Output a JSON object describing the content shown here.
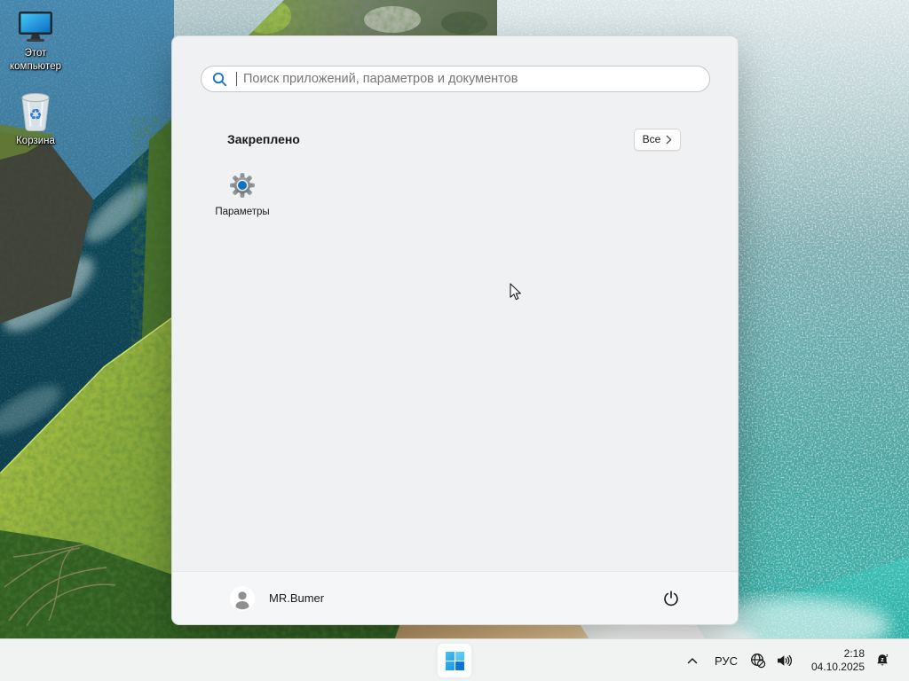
{
  "desktop": {
    "icons": [
      {
        "label": "Этот компьютер"
      },
      {
        "label": "Корзина"
      }
    ]
  },
  "start_menu": {
    "search_placeholder": "Поиск приложений, параметров и документов",
    "pinned_header": "Закреплено",
    "all_button_label": "Все",
    "pinned_apps": [
      {
        "label": "Параметры"
      }
    ],
    "user_name": "MR.Bumer"
  },
  "taskbar": {
    "language": "РУС",
    "time": "2:18",
    "date": "04.10.2025"
  },
  "colors": {
    "accent_blue": "#1173c0",
    "search_icon_blue": "#1676d2",
    "menu_bg": "#f0f1f2",
    "user_bar_bg": "#f5f6f7",
    "taskbar_bg": "#f1f2f2",
    "windows_logo_blue": "#0b74d9"
  }
}
